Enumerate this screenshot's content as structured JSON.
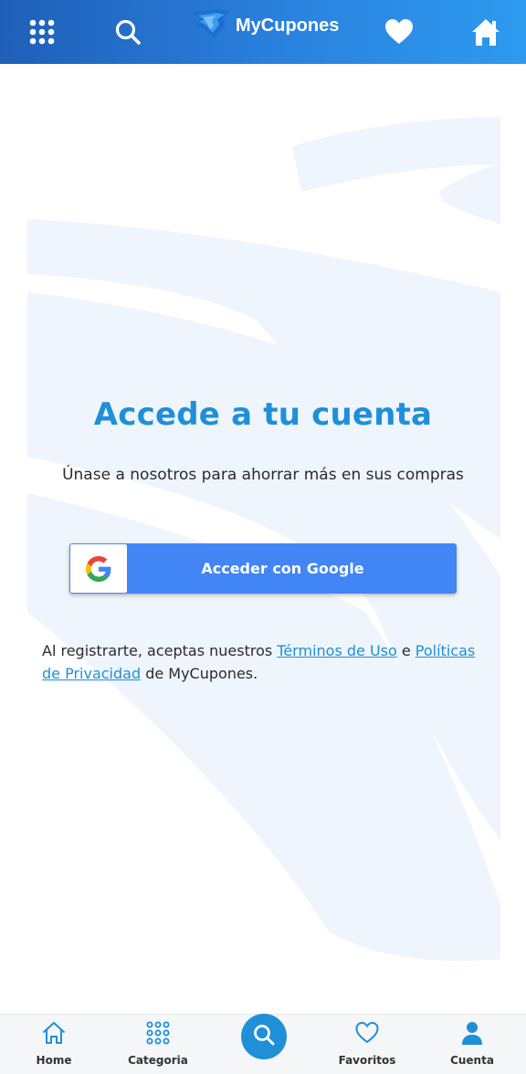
{
  "header": {
    "brand": "MyCupones",
    "icons": [
      "grid-menu-icon",
      "search-icon",
      "brand-logo-icon",
      "heart-icon",
      "home-icon"
    ]
  },
  "main": {
    "title": "Accede a tu cuenta",
    "subtitle": "Únase a nosotros para ahorrar más en sus compras",
    "google_button_label": "Acceder con Google",
    "legal": {
      "prefix": "Al registrarte, aceptas nuestros ",
      "terms_link": "Términos de Uso",
      "connector": " e ",
      "privacy_link": "Políticas de Privacidad",
      "suffix": " de MyCupones."
    }
  },
  "bottom_nav": {
    "items": [
      {
        "label": "Home",
        "icon": "home-icon"
      },
      {
        "label": "Categoria",
        "icon": "grid-icon"
      },
      {
        "label": "",
        "icon": "search-icon"
      },
      {
        "label": "Favoritos",
        "icon": "heart-icon"
      },
      {
        "label": "Cuenta",
        "icon": "user-icon"
      }
    ]
  },
  "colors": {
    "header_start": "#1f5fb8",
    "header_end": "#2d9af0",
    "accent": "#1f8fd8",
    "google_blue": "#4285f4"
  }
}
